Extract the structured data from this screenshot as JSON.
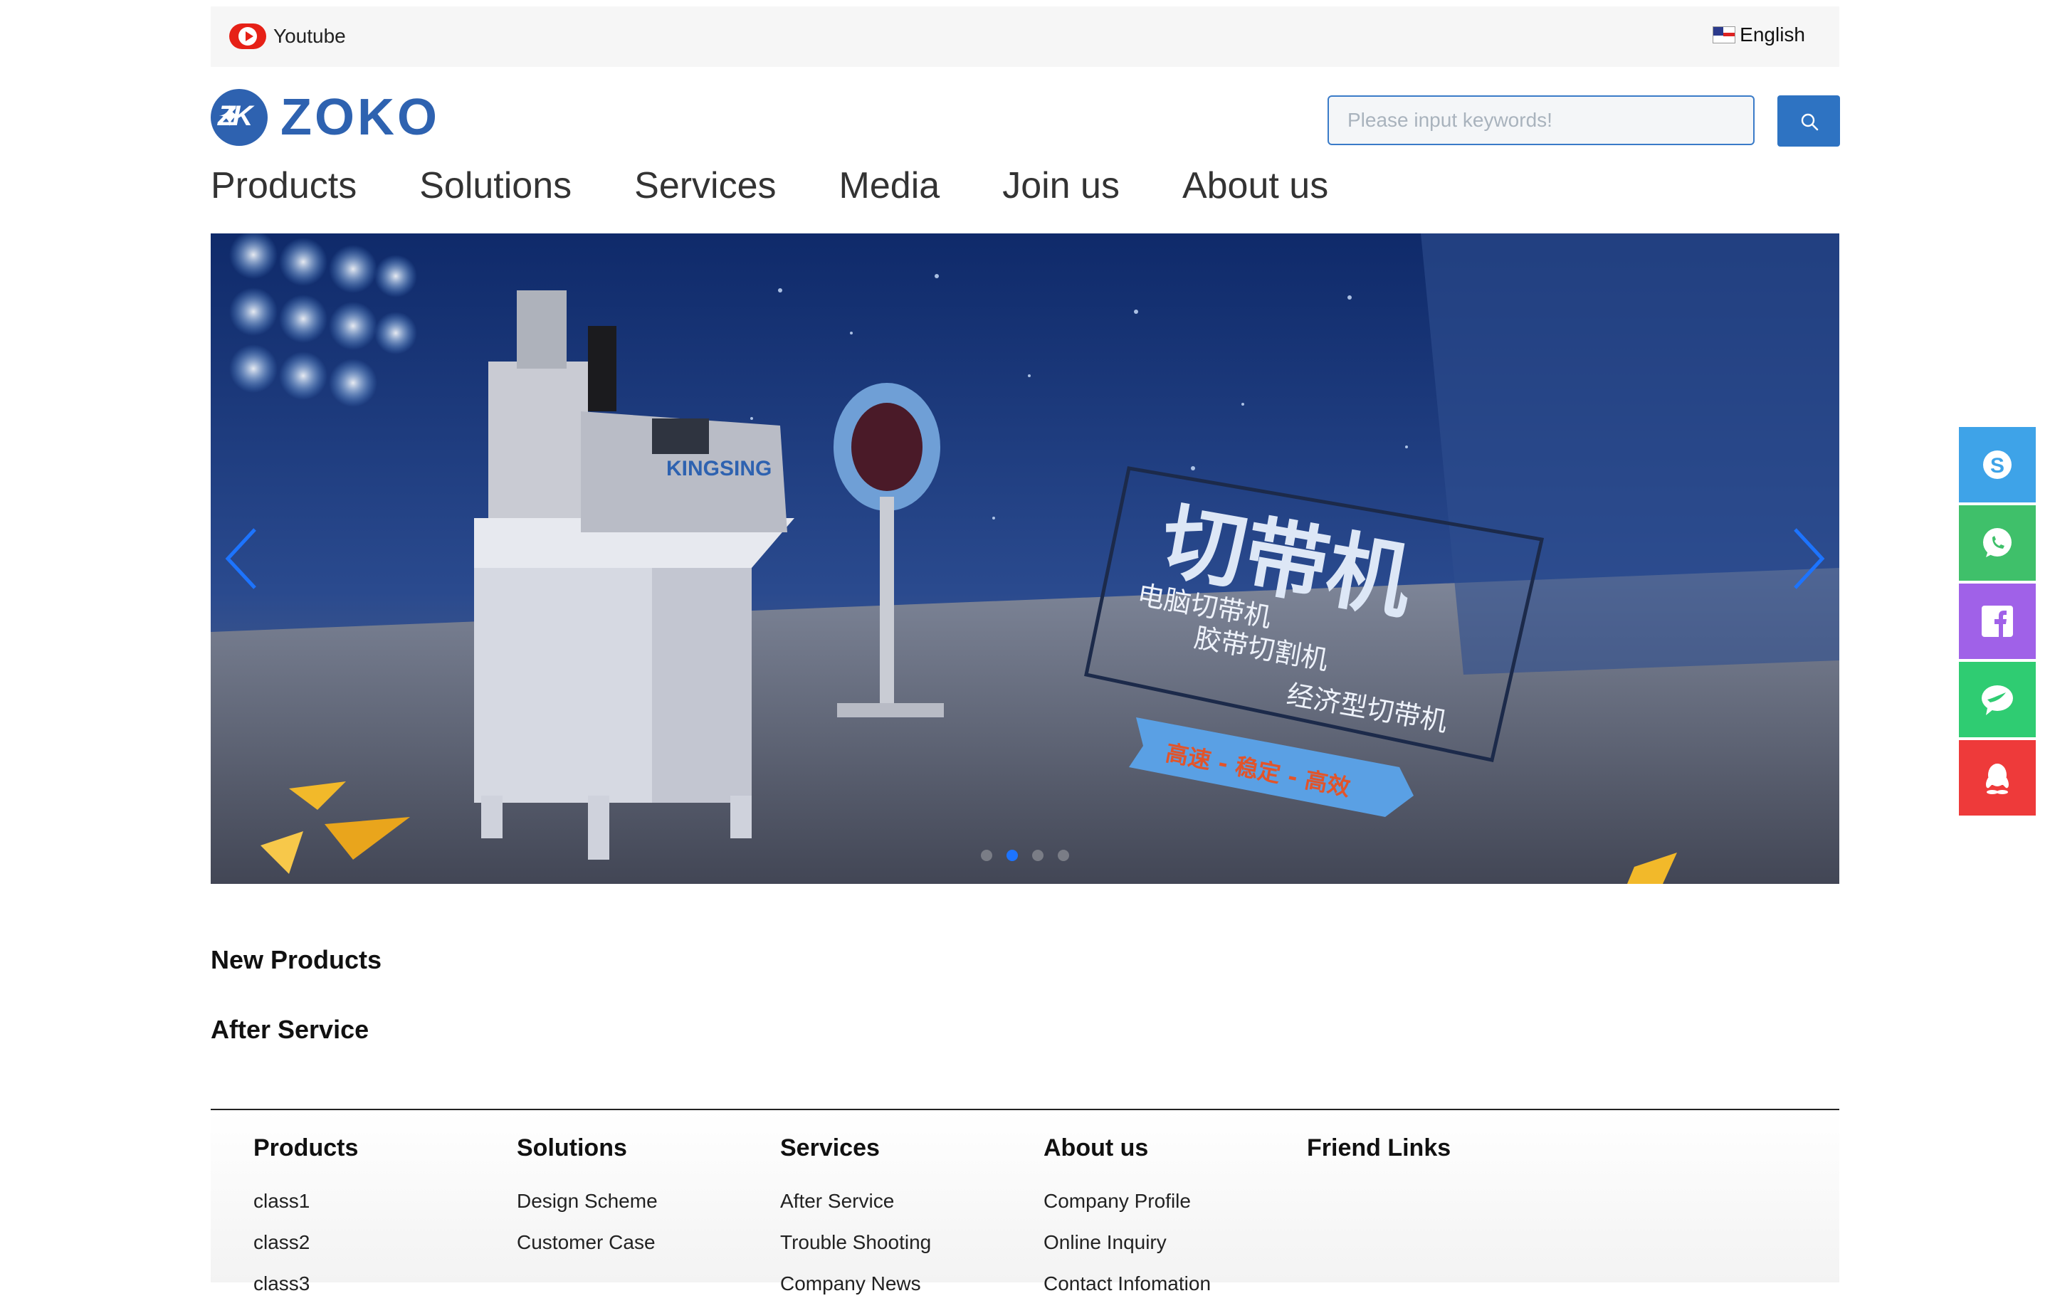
{
  "topbar": {
    "youtube_label": "Youtube",
    "language_label": "English"
  },
  "header": {
    "logo_text": "ZOKO",
    "logo_mark": "ZK",
    "search_placeholder": "Please input keywords!"
  },
  "nav": [
    "Products",
    "Solutions",
    "Services",
    "Media",
    "Join us",
    "About us"
  ],
  "banner": {
    "brand_on_machine": "KINGSING",
    "headline": "切带机",
    "bullets": [
      "电脑切带机",
      "胶带切割机",
      "经济型切带机"
    ],
    "tagline": "高速 - 稳定 - 高效",
    "active_slide": 2,
    "slide_count": 4
  },
  "sections": {
    "new_products": "New Products",
    "after_service": "After Service"
  },
  "footer": {
    "columns": [
      {
        "title": "Products",
        "links": [
          "class1",
          "class2",
          "class3"
        ]
      },
      {
        "title": "Solutions",
        "links": [
          "Design Scheme",
          "Customer Case"
        ]
      },
      {
        "title": "Services",
        "links": [
          "After Service",
          "Trouble Shooting",
          "Company News"
        ]
      },
      {
        "title": "About us",
        "links": [
          "Company Profile",
          "Online Inquiry",
          "Contact Infomation"
        ]
      },
      {
        "title": "Friend Links",
        "links": []
      }
    ]
  },
  "side_float": [
    {
      "icon": "skype-icon",
      "color": "#3ea3e8"
    },
    {
      "icon": "whatsapp-icon",
      "color": "#3fc06a"
    },
    {
      "icon": "facebook-icon",
      "color": "#a061e8"
    },
    {
      "icon": "chat-icon",
      "color": "#2fcc72"
    },
    {
      "icon": "qq-icon",
      "color": "#ee3a3a"
    }
  ],
  "colors": {
    "brand": "#2e62b0",
    "accent": "#2e73c2"
  }
}
